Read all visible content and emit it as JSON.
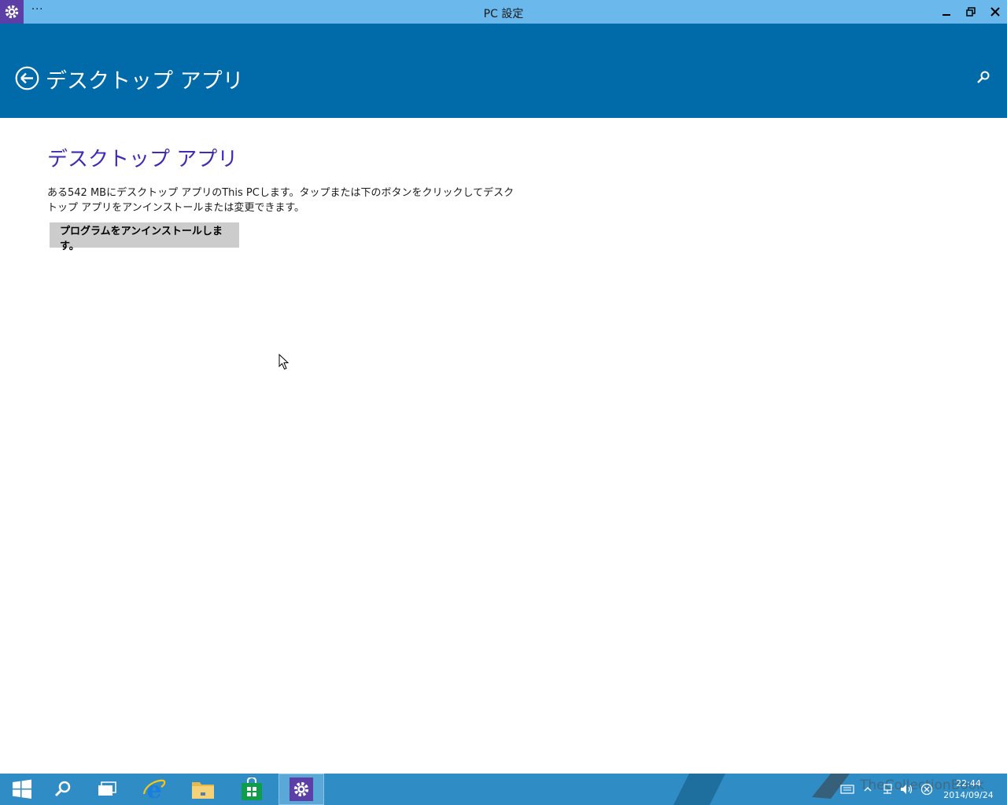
{
  "window": {
    "title": "PC 設定",
    "menu_label": "···"
  },
  "header": {
    "title": "デスクトップ アプリ"
  },
  "main": {
    "section_title": "デスクトップ アプリ",
    "description": "ある542 MBにデスクトップ アプリのThis PCします。タップまたは下のボタンをクリックしてデスクトップ アプリをアンインストールまたは変更できます。",
    "uninstall_button": "プログラムをアンインストールします。"
  },
  "taskbar": {
    "items": [
      "start",
      "search",
      "task-view",
      "internet-explorer",
      "file-explorer",
      "store",
      "pc-settings"
    ],
    "active_item": "pc-settings",
    "clock_time": "22:44",
    "clock_date": "2014/09/24"
  },
  "watermark": {
    "text": "TheCollectionBook"
  },
  "colors": {
    "titlebar": "#6ab8ec",
    "header": "#006ba8",
    "accent_title": "#3f2bb4",
    "taskbar": "#2f8cc4",
    "button": "#cccccc"
  }
}
